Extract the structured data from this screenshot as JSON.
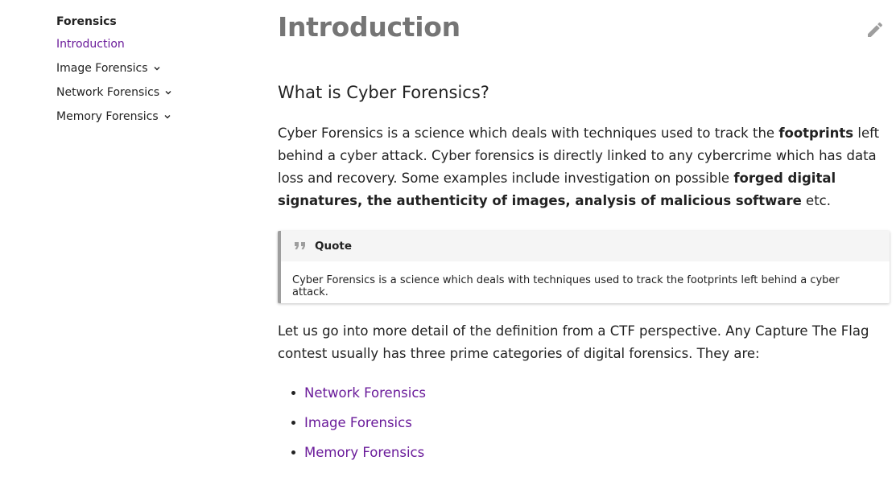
{
  "sidebar": {
    "section_title": "Forensics",
    "items": [
      {
        "label": "Introduction",
        "active": true,
        "expandable": false
      },
      {
        "label": "Image Forensics",
        "active": false,
        "expandable": true
      },
      {
        "label": "Network Forensics",
        "active": false,
        "expandable": true
      },
      {
        "label": "Memory Forensics",
        "active": false,
        "expandable": true
      }
    ]
  },
  "main": {
    "title": "Introduction",
    "edit_icon": "pencil-icon",
    "subtitle": "What is Cyber Forensics?",
    "paragraph1": {
      "part1": "Cyber Forensics is a science which deals with techniques used to track the ",
      "bold1": "footprints",
      "part2": " left behind a cyber attack. Cyber forensics is directly linked to any cybercrime which has data loss and recovery. Some examples include investigation on possible ",
      "bold2": "forged digital signatures, the authenticity of images, analysis of malicious software",
      "part3": " etc."
    },
    "quote": {
      "label": "Quote",
      "icon": "quote-icon",
      "text": "Cyber Forensics is a science which deals with techniques used to track the footprints left behind a cyber attack."
    },
    "paragraph2": "Let us go into more detail of the definition from a CTF perspective. Any Capture The Flag contest usually has three prime categories of digital forensics. They are:",
    "categories": [
      "Network Forensics",
      "Image Forensics",
      "Memory Forensics"
    ]
  },
  "colors": {
    "link": "#6a1b9a",
    "title": "#757575",
    "quote_border": "#9e9e9e",
    "quote_header_bg": "#f5f5f5"
  }
}
